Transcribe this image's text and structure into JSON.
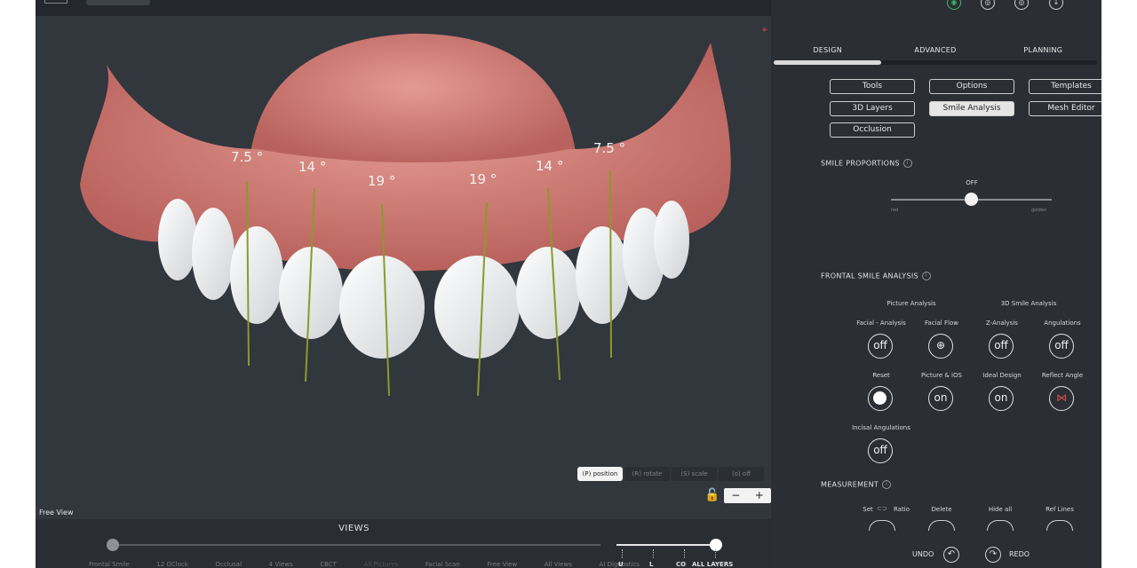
{
  "viewport": {
    "mode_label": "Free View",
    "measurements": [
      "7.5 °",
      "14 °",
      "19 °",
      "19 °",
      "14 °",
      "7.5 °"
    ],
    "transform_modes": [
      "(P) position",
      "(R) rotate",
      "(S) scale",
      "(o) off"
    ],
    "zoom_minus": "−",
    "zoom_plus": "+"
  },
  "views": {
    "title": "VIEWS",
    "items": [
      "Frontal Smile",
      "12 OClock",
      "Occlusal",
      "4 Views",
      "CBCT",
      "All Pictures",
      "Facial Scan",
      "Free View",
      "All Views",
      "AI Dignostics"
    ],
    "layer_labels": [
      "U",
      "L",
      "CO",
      "ALL LAYERS"
    ]
  },
  "panel": {
    "tabs": [
      "DESIGN",
      "ADVANCED",
      "PLANNING"
    ],
    "buttons": [
      "Tools",
      "Options",
      "Templates",
      "3D Layers",
      "Smile Analysis",
      "Mesh Editor",
      "Occlusion"
    ],
    "active_button": "Smile Analysis",
    "smile_proportions": {
      "title": "SMILE PROPORTIONS",
      "state": "OFF",
      "left_label": "red",
      "right_label": "golden"
    },
    "frontal": {
      "title": "FRONTAL SMILE ANALYSIS",
      "group_picture": "Picture Analysis",
      "group_3d": "3D Smile Analysis",
      "controls": [
        {
          "label": "Facial - Analysis",
          "state": "off"
        },
        {
          "label": "Facial Flow",
          "state": ""
        },
        {
          "label": "Z-Analysis",
          "state": "off"
        },
        {
          "label": "Angulations",
          "state": "off"
        },
        {
          "label": "Reset",
          "state": ""
        },
        {
          "label": "Picture & iOS",
          "state": "on"
        },
        {
          "label": "Ideal Design",
          "state": "on"
        },
        {
          "label": "Reflect Angle",
          "state": ""
        },
        {
          "label": "Incisal Angulations",
          "state": "off"
        }
      ]
    },
    "measurement": {
      "title": "MEASUREMENT",
      "set": "Set",
      "ratio": "Ratio",
      "delete": "Delete",
      "hide_all": "Hide all",
      "ref_lines": "Ref Lines"
    },
    "undo": "UNDO",
    "redo": "REDO"
  },
  "colors": {
    "accent_line": "#8a9a2a",
    "gum": "#d4807a",
    "active_icon": "#3fb76b"
  }
}
